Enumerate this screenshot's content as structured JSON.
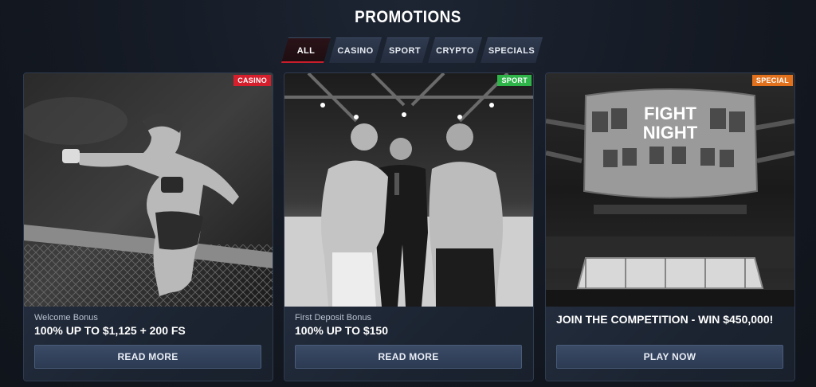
{
  "page": {
    "title": "PROMOTIONS"
  },
  "tabs": [
    {
      "label": "ALL",
      "active": true
    },
    {
      "label": "CASINO",
      "active": false
    },
    {
      "label": "SPORT",
      "active": false
    },
    {
      "label": "CRYPTO",
      "active": false
    },
    {
      "label": "SPECIALS",
      "active": false
    }
  ],
  "cards": [
    {
      "badge": "CASINO",
      "badge_color": "#d61f2c",
      "subtitle": "Welcome Bonus",
      "headline": "100% UP TO $1,125 + 200 FS",
      "button": "READ MORE"
    },
    {
      "badge": "SPORT",
      "badge_color": "#2fb44a",
      "subtitle": "First Deposit Bonus",
      "headline": "100% UP TO $150",
      "button": "READ MORE"
    },
    {
      "badge": "SPECIAL",
      "badge_color": "#e2711d",
      "subtitle": "",
      "headline": "JOIN THE COMPETITION - WIN $450,000!",
      "button": "PLAY NOW",
      "image_text": "FIGHT NIGHT"
    }
  ],
  "colors": {
    "accent_red": "#c81e2c",
    "background": "#141a24",
    "card": "#1c2431"
  }
}
